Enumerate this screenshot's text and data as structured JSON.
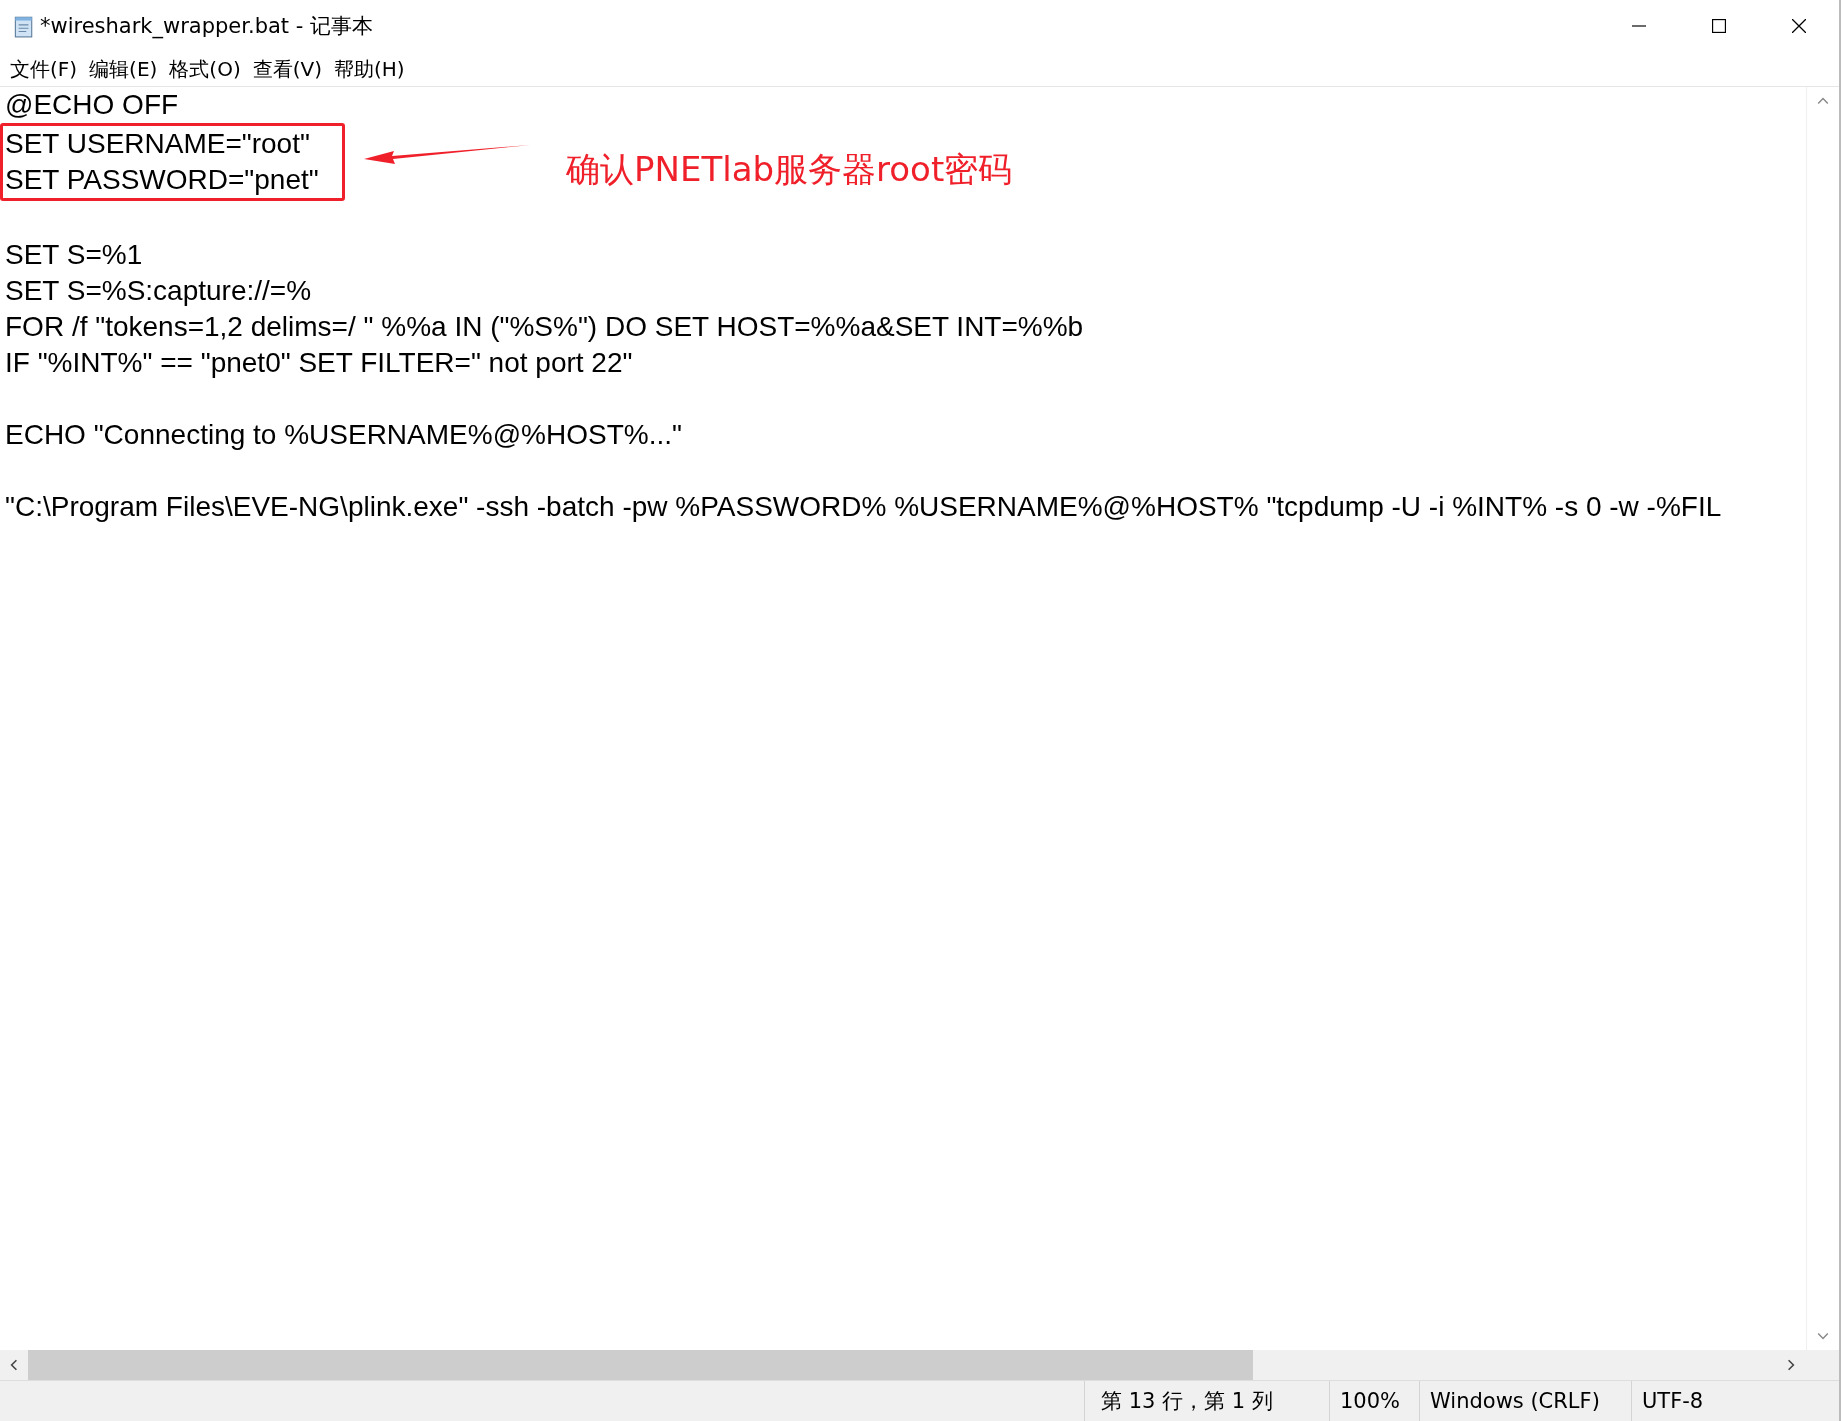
{
  "window": {
    "title": "*wireshark_wrapper.bat - 记事本"
  },
  "menu": [
    "文件(F)",
    "编辑(E)",
    "格式(O)",
    "查看(V)",
    "帮助(H)"
  ],
  "lines": [
    {
      "text": "@ECHO OFF",
      "blank_before": false,
      "highlighted": false
    },
    {
      "text": "SET USERNAME=\"root\"",
      "blank_before": false,
      "highlighted": true
    },
    {
      "text": "SET PASSWORD=\"pnet\"",
      "blank_before": false,
      "highlighted": true
    },
    {
      "text": "SET S=%1",
      "blank_before": true,
      "highlighted": false
    },
    {
      "text": "SET S=%S:capture://=%",
      "blank_before": false,
      "highlighted": false
    },
    {
      "text": "FOR /f \"tokens=1,2 delims=/ \" %%a IN (\"%S%\") DO SET HOST=%%a&SET INT=%%b",
      "blank_before": false,
      "highlighted": false
    },
    {
      "text": "IF \"%INT%\" == \"pnet0\" SET FILTER=\" not port 22\"",
      "blank_before": false,
      "highlighted": false
    },
    {
      "text": "ECHO \"Connecting to %USERNAME%@%HOST%...\"",
      "blank_before": true,
      "highlighted": false
    },
    {
      "text": "\"C:\\Program Files\\EVE-NG\\plink.exe\" -ssh -batch -pw %PASSWORD% %USERNAME%@%HOST% \"tcpdump -U -i %INT% -s 0 -w -%FIL",
      "blank_before": true,
      "highlighted": false
    }
  ],
  "annotation": {
    "text": "确认PNETlab服务器root密码"
  },
  "status_bar": [
    "第 13 行，第 1 列",
    "100%",
    "Windows (CRLF)",
    "UTF-8"
  ]
}
